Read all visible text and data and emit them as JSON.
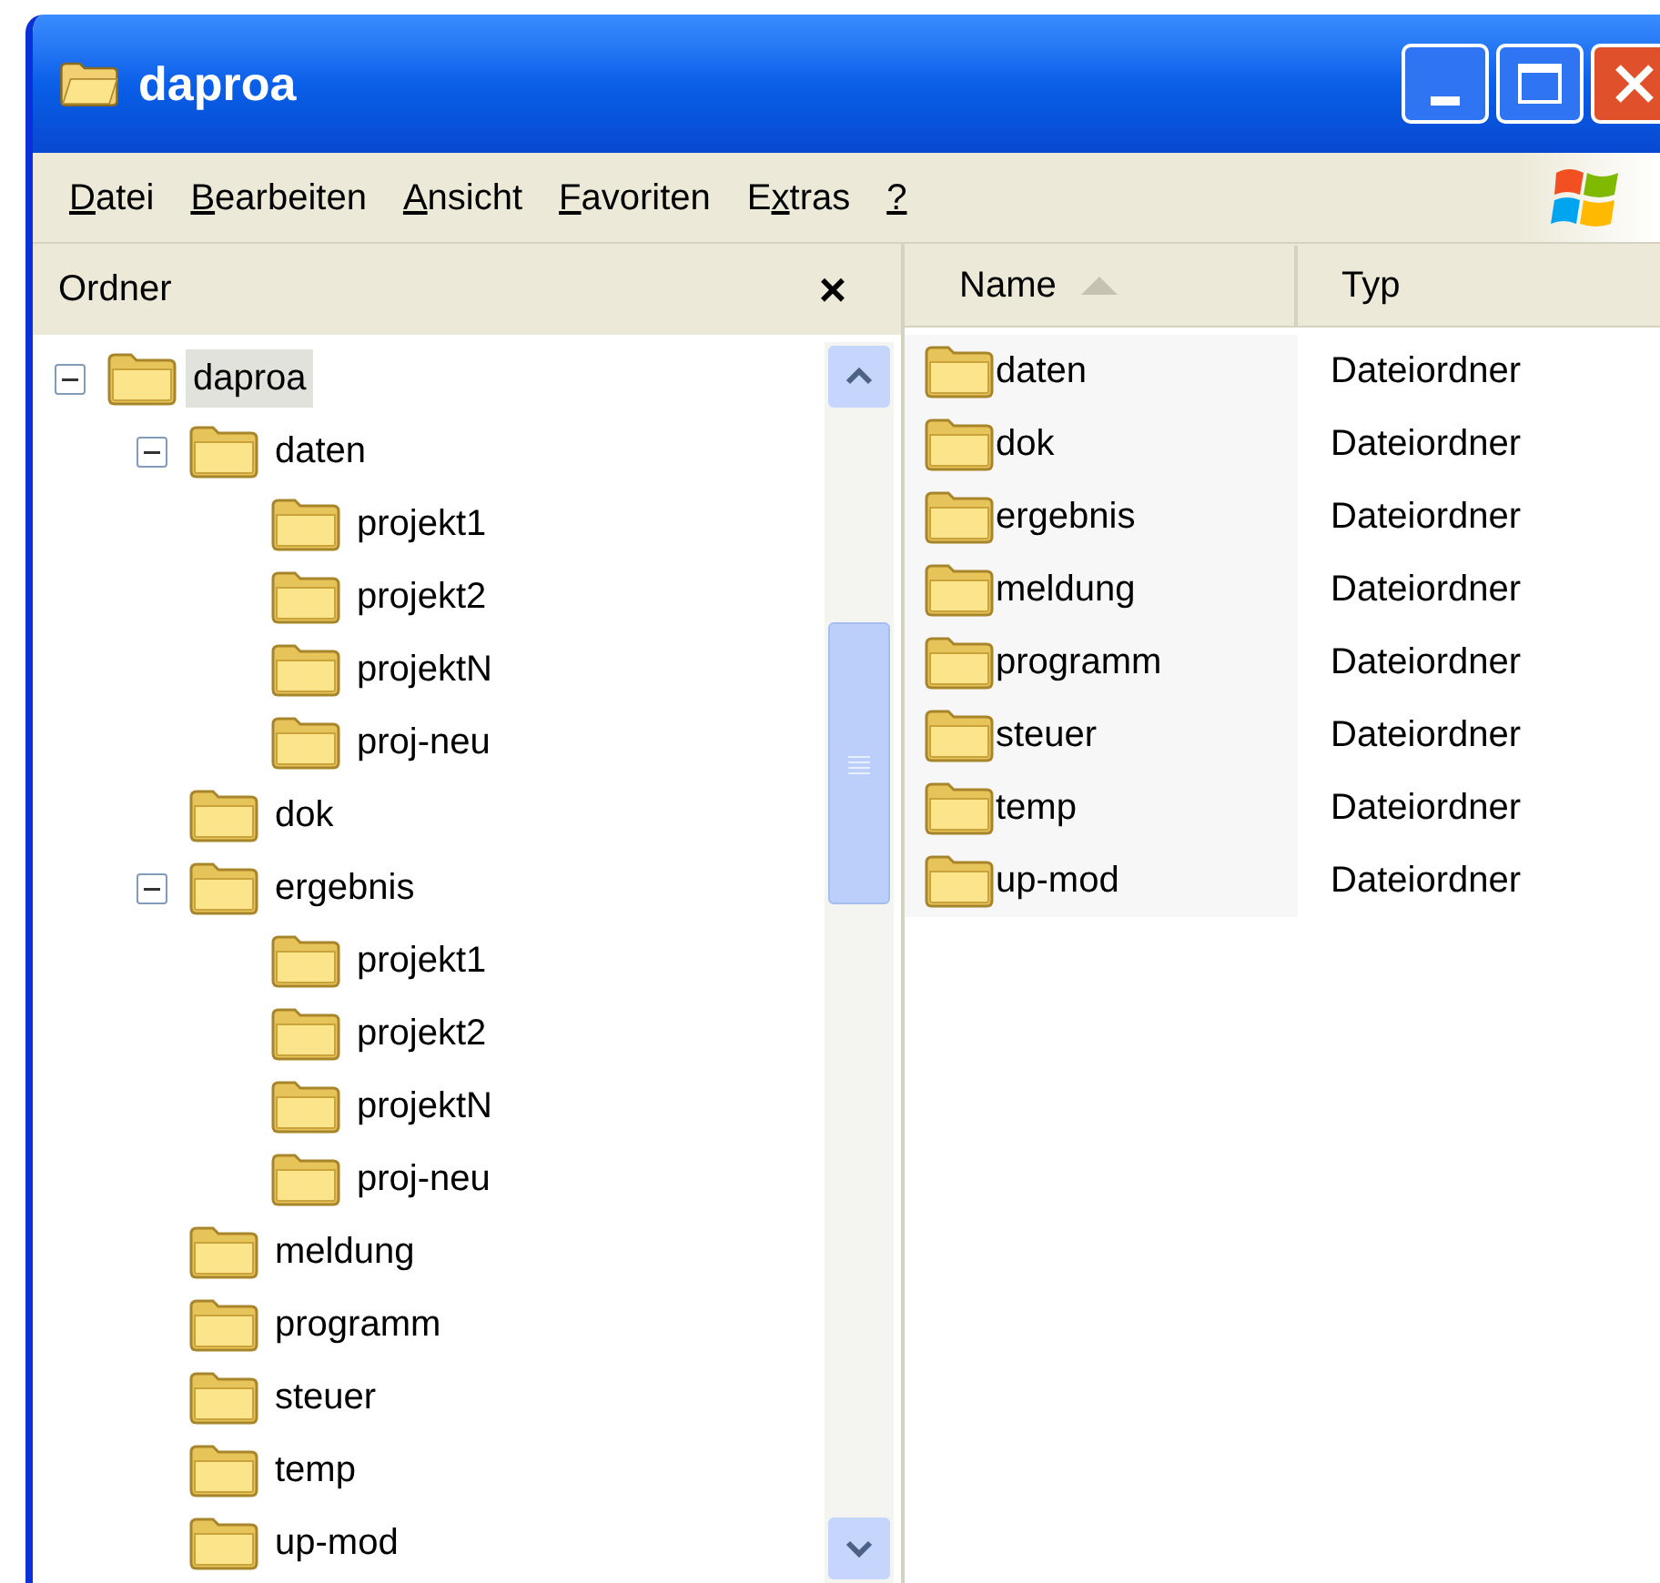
{
  "window": {
    "title": "daproa"
  },
  "menu": [
    {
      "key": "D",
      "rest": "atei"
    },
    {
      "key": "B",
      "rest": "earbeiten"
    },
    {
      "key": "A",
      "rest": "nsicht"
    },
    {
      "key": "F",
      "rest": "avoriten"
    },
    {
      "lead": "E",
      "key": "x",
      "rest": "tras"
    },
    {
      "key": "?"
    }
  ],
  "folders_pane": {
    "title": "Ordner",
    "close": "×"
  },
  "tree": [
    {
      "label": "daproa",
      "selected": true,
      "expanded": true,
      "children": [
        {
          "label": "daten",
          "selected": false,
          "expanded": true,
          "children": [
            {
              "label": "projekt1",
              "selected": false
            },
            {
              "label": "projekt2",
              "selected": false
            },
            {
              "label": "projektN",
              "selected": false
            },
            {
              "label": "proj-neu",
              "selected": false
            }
          ]
        },
        {
          "label": "dok",
          "selected": false
        },
        {
          "label": "ergebnis",
          "selected": false,
          "expanded": true,
          "children": [
            {
              "label": "projekt1",
              "selected": false
            },
            {
              "label": "projekt2",
              "selected": false
            },
            {
              "label": "projektN",
              "selected": false
            },
            {
              "label": "proj-neu",
              "selected": false
            }
          ]
        },
        {
          "label": "meldung",
          "selected": false
        },
        {
          "label": "programm",
          "selected": false
        },
        {
          "label": "steuer",
          "selected": false
        },
        {
          "label": "temp",
          "selected": false
        },
        {
          "label": "up-mod",
          "selected": false
        }
      ]
    }
  ],
  "list": {
    "columns": [
      {
        "label": "Name",
        "sorted": true
      },
      {
        "label": "Typ",
        "sorted": false
      }
    ],
    "rows": [
      {
        "name": "daten",
        "type": "Dateiordner"
      },
      {
        "name": "dok",
        "type": "Dateiordner"
      },
      {
        "name": "ergebnis",
        "type": "Dateiordner"
      },
      {
        "name": "meldung",
        "type": "Dateiordner"
      },
      {
        "name": "programm",
        "type": "Dateiordner"
      },
      {
        "name": "steuer",
        "type": "Dateiordner"
      },
      {
        "name": "temp",
        "type": "Dateiordner"
      },
      {
        "name": "up-mod",
        "type": "Dateiordner"
      }
    ]
  }
}
